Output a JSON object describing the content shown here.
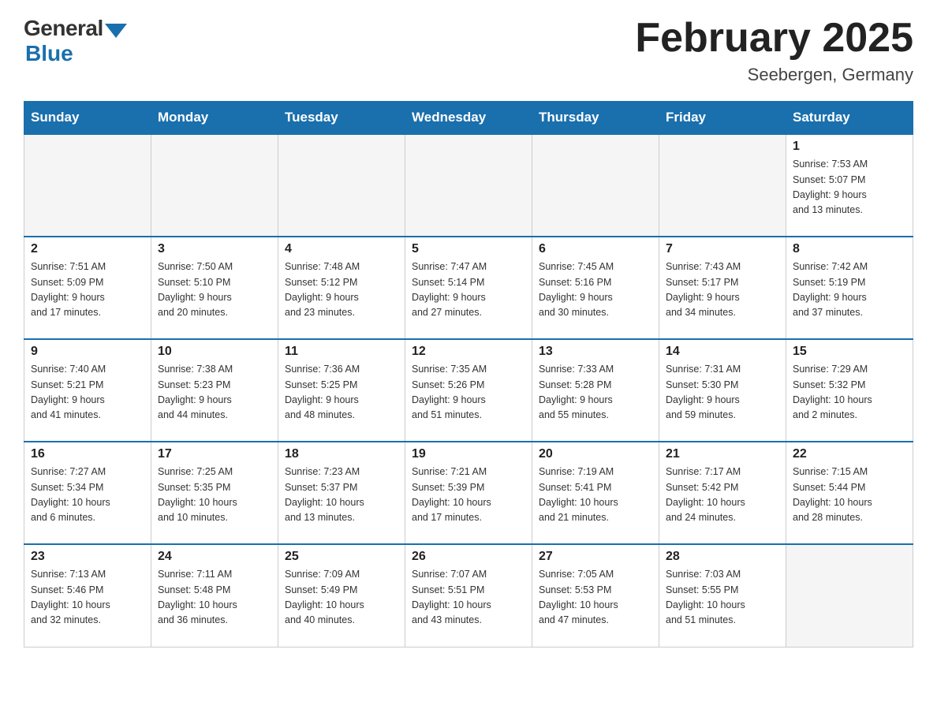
{
  "header": {
    "logo_general": "General",
    "logo_blue": "Blue",
    "month_title": "February 2025",
    "location": "Seebergen, Germany"
  },
  "weekdays": [
    "Sunday",
    "Monday",
    "Tuesday",
    "Wednesday",
    "Thursday",
    "Friday",
    "Saturday"
  ],
  "weeks": [
    [
      {
        "day": "",
        "info": ""
      },
      {
        "day": "",
        "info": ""
      },
      {
        "day": "",
        "info": ""
      },
      {
        "day": "",
        "info": ""
      },
      {
        "day": "",
        "info": ""
      },
      {
        "day": "",
        "info": ""
      },
      {
        "day": "1",
        "info": "Sunrise: 7:53 AM\nSunset: 5:07 PM\nDaylight: 9 hours\nand 13 minutes."
      }
    ],
    [
      {
        "day": "2",
        "info": "Sunrise: 7:51 AM\nSunset: 5:09 PM\nDaylight: 9 hours\nand 17 minutes."
      },
      {
        "day": "3",
        "info": "Sunrise: 7:50 AM\nSunset: 5:10 PM\nDaylight: 9 hours\nand 20 minutes."
      },
      {
        "day": "4",
        "info": "Sunrise: 7:48 AM\nSunset: 5:12 PM\nDaylight: 9 hours\nand 23 minutes."
      },
      {
        "day": "5",
        "info": "Sunrise: 7:47 AM\nSunset: 5:14 PM\nDaylight: 9 hours\nand 27 minutes."
      },
      {
        "day": "6",
        "info": "Sunrise: 7:45 AM\nSunset: 5:16 PM\nDaylight: 9 hours\nand 30 minutes."
      },
      {
        "day": "7",
        "info": "Sunrise: 7:43 AM\nSunset: 5:17 PM\nDaylight: 9 hours\nand 34 minutes."
      },
      {
        "day": "8",
        "info": "Sunrise: 7:42 AM\nSunset: 5:19 PM\nDaylight: 9 hours\nand 37 minutes."
      }
    ],
    [
      {
        "day": "9",
        "info": "Sunrise: 7:40 AM\nSunset: 5:21 PM\nDaylight: 9 hours\nand 41 minutes."
      },
      {
        "day": "10",
        "info": "Sunrise: 7:38 AM\nSunset: 5:23 PM\nDaylight: 9 hours\nand 44 minutes."
      },
      {
        "day": "11",
        "info": "Sunrise: 7:36 AM\nSunset: 5:25 PM\nDaylight: 9 hours\nand 48 minutes."
      },
      {
        "day": "12",
        "info": "Sunrise: 7:35 AM\nSunset: 5:26 PM\nDaylight: 9 hours\nand 51 minutes."
      },
      {
        "day": "13",
        "info": "Sunrise: 7:33 AM\nSunset: 5:28 PM\nDaylight: 9 hours\nand 55 minutes."
      },
      {
        "day": "14",
        "info": "Sunrise: 7:31 AM\nSunset: 5:30 PM\nDaylight: 9 hours\nand 59 minutes."
      },
      {
        "day": "15",
        "info": "Sunrise: 7:29 AM\nSunset: 5:32 PM\nDaylight: 10 hours\nand 2 minutes."
      }
    ],
    [
      {
        "day": "16",
        "info": "Sunrise: 7:27 AM\nSunset: 5:34 PM\nDaylight: 10 hours\nand 6 minutes."
      },
      {
        "day": "17",
        "info": "Sunrise: 7:25 AM\nSunset: 5:35 PM\nDaylight: 10 hours\nand 10 minutes."
      },
      {
        "day": "18",
        "info": "Sunrise: 7:23 AM\nSunset: 5:37 PM\nDaylight: 10 hours\nand 13 minutes."
      },
      {
        "day": "19",
        "info": "Sunrise: 7:21 AM\nSunset: 5:39 PM\nDaylight: 10 hours\nand 17 minutes."
      },
      {
        "day": "20",
        "info": "Sunrise: 7:19 AM\nSunset: 5:41 PM\nDaylight: 10 hours\nand 21 minutes."
      },
      {
        "day": "21",
        "info": "Sunrise: 7:17 AM\nSunset: 5:42 PM\nDaylight: 10 hours\nand 24 minutes."
      },
      {
        "day": "22",
        "info": "Sunrise: 7:15 AM\nSunset: 5:44 PM\nDaylight: 10 hours\nand 28 minutes."
      }
    ],
    [
      {
        "day": "23",
        "info": "Sunrise: 7:13 AM\nSunset: 5:46 PM\nDaylight: 10 hours\nand 32 minutes."
      },
      {
        "day": "24",
        "info": "Sunrise: 7:11 AM\nSunset: 5:48 PM\nDaylight: 10 hours\nand 36 minutes."
      },
      {
        "day": "25",
        "info": "Sunrise: 7:09 AM\nSunset: 5:49 PM\nDaylight: 10 hours\nand 40 minutes."
      },
      {
        "day": "26",
        "info": "Sunrise: 7:07 AM\nSunset: 5:51 PM\nDaylight: 10 hours\nand 43 minutes."
      },
      {
        "day": "27",
        "info": "Sunrise: 7:05 AM\nSunset: 5:53 PM\nDaylight: 10 hours\nand 47 minutes."
      },
      {
        "day": "28",
        "info": "Sunrise: 7:03 AM\nSunset: 5:55 PM\nDaylight: 10 hours\nand 51 minutes."
      },
      {
        "day": "",
        "info": ""
      }
    ]
  ]
}
